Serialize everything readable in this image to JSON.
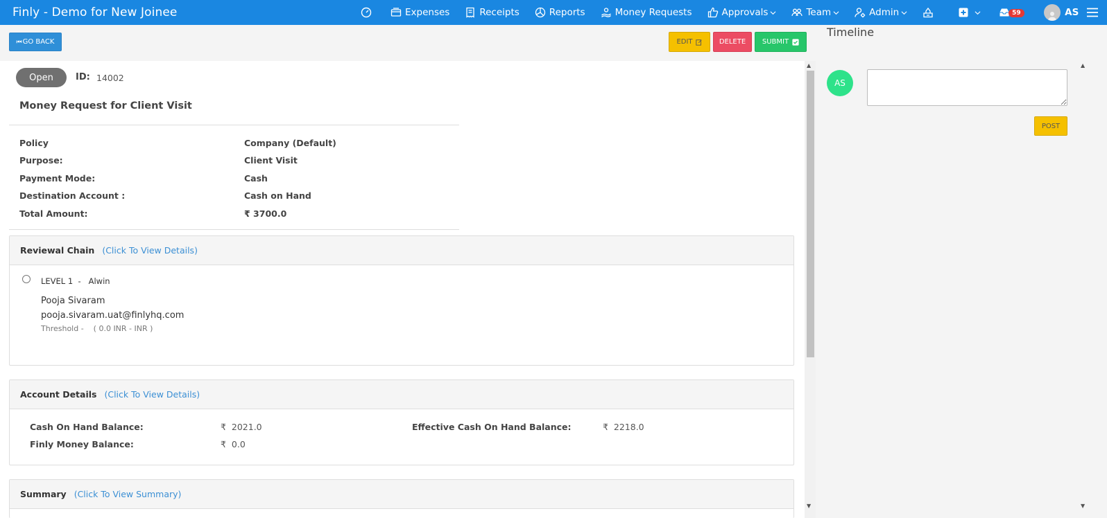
{
  "header": {
    "brand": "Finly - Demo for New Joinee",
    "nav": [
      {
        "label": "",
        "icon": "dashboard-icon"
      },
      {
        "label": "Expenses",
        "icon": "expenses-icon"
      },
      {
        "label": "Receipts",
        "icon": "receipts-icon"
      },
      {
        "label": "Reports",
        "icon": "reports-icon"
      },
      {
        "label": "Money Requests",
        "icon": "money-requests-icon"
      },
      {
        "label": "Approvals",
        "icon": "approvals-icon"
      },
      {
        "label": "Team",
        "icon": "team-icon"
      },
      {
        "label": "Admin",
        "icon": "admin-icon"
      }
    ],
    "notification_count": "59",
    "user_initials": "AS"
  },
  "actions": {
    "go_back": "GO BACK",
    "edit": "EDIT",
    "delete": "DELETE",
    "submit": "SUBMIT"
  },
  "request": {
    "status": "Open",
    "id_label": "ID:",
    "id_value": "14002",
    "title": "Money Request for Client Visit",
    "details": [
      {
        "label": "Policy",
        "value": "Company (Default)"
      },
      {
        "label": "Purpose:",
        "value": "Client Visit"
      },
      {
        "label": "Payment Mode:",
        "value": "Cash"
      },
      {
        "label": "Destination Account :",
        "value": "Cash on Hand"
      },
      {
        "label": "Total Amount:",
        "value": "₹ 3700.0"
      }
    ]
  },
  "reviewal_chain": {
    "title": "Reviewal Chain",
    "link": "(Click To View Details)",
    "level": "LEVEL 1  -   Alwin",
    "reviewer_name": "Pooja Sivaram",
    "reviewer_email": "pooja.sivaram.uat@finlyhq.com",
    "threshold": "Threshold -    ( 0.0 INR - INR )"
  },
  "account_details": {
    "title": "Account Details",
    "link": "(Click To View Details)",
    "cash_on_hand_label": "Cash On Hand Balance:",
    "cash_on_hand_value": "₹  2021.0",
    "effective_label": "Effective Cash On Hand Balance:",
    "effective_value": "₹  2218.0",
    "finly_label": "Finly Money Balance:",
    "finly_value": "₹  0.0"
  },
  "summary": {
    "title": "Summary",
    "link": "(Click To View Summary)"
  },
  "timeline": {
    "title": "Timeline",
    "avatar": "AS",
    "post": "POST"
  },
  "colors": {
    "topbar": "#1a87e1",
    "edit": "#f5c000",
    "delete": "#ec4c63",
    "submit": "#27c66a",
    "link": "#3b8fd4",
    "avatar": "#2ee28a"
  }
}
